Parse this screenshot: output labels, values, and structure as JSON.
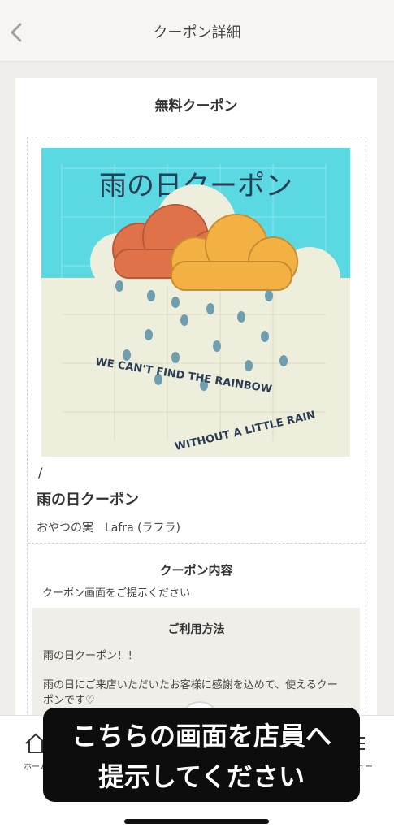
{
  "header": {
    "back_icon": "chevron-left-icon",
    "title": "クーポン詳細"
  },
  "card": {
    "title": "無料クーポン",
    "image": {
      "title": "雨の日クーポン",
      "caption_line1": "WE CAN'T FIND THE RAINBOW",
      "caption_line2": "WITHOUT A LITTLE RAIN",
      "bg_color": "#5ad9e2"
    },
    "slash": "/",
    "coupon_name": "雨の日クーポン",
    "shop_name": "おやつの実　Lafra (ラフラ)",
    "content_heading": "クーポン内容",
    "content_text": "クーポン画面をご提示ください",
    "usage": {
      "heading": "ご利用方法",
      "line1": "雨の日クーポン！！",
      "line2": "雨の日にご来店いただいたお客様に感謝を込めて、使えるクーポンです♡"
    }
  },
  "tabbar": {
    "home_label": "ホーム",
    "home_icon": "home-icon",
    "menu_label": "メニュー",
    "menu_icon": "menu-icon"
  },
  "overlay": {
    "line1": "こちらの画面を店員へ",
    "line2": "提示してください"
  }
}
